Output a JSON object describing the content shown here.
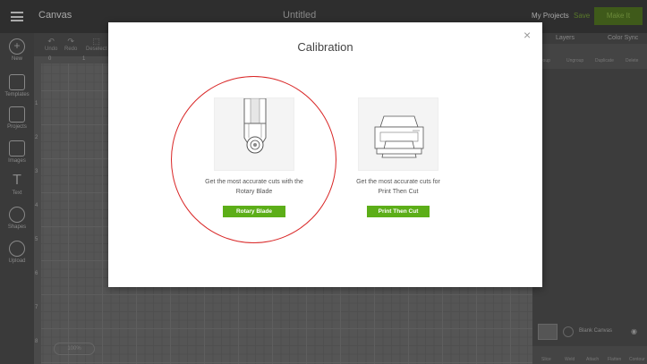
{
  "app": {
    "title": "Canvas",
    "document_title": "Untitled"
  },
  "header": {
    "my_projects": "My Projects",
    "save": "Save",
    "make_it": "Make It"
  },
  "sidebar": {
    "items": [
      {
        "label": "New",
        "icon": "plus-icon"
      },
      {
        "label": "Templates",
        "icon": "shirt-icon"
      },
      {
        "label": "Projects",
        "icon": "projects-icon"
      },
      {
        "label": "Images",
        "icon": "image-icon"
      },
      {
        "label": "Text",
        "icon": "text-icon"
      },
      {
        "label": "Shapes",
        "icon": "shapes-icon"
      },
      {
        "label": "Upload",
        "icon": "upload-icon"
      }
    ]
  },
  "toolbar": {
    "undo": "Undo",
    "redo": "Redo",
    "deselect": "Deselect"
  },
  "ruler": {
    "top": [
      "0",
      "1"
    ],
    "left": [
      "1",
      "2",
      "3",
      "4",
      "5",
      "6",
      "7",
      "8"
    ]
  },
  "right_panel": {
    "tabs": {
      "layers": "Layers",
      "color_sync": "Color Sync"
    },
    "tools": [
      "Group",
      "Ungroup",
      "Duplicate",
      "Delete"
    ],
    "blank_canvas": "Blank Canvas",
    "bottom_tools": [
      "Slice",
      "Weld",
      "Attach",
      "Flatten",
      "Contour"
    ]
  },
  "zoom_label": "100%",
  "modal": {
    "title": "Calibration",
    "close": "×",
    "options": [
      {
        "line1": "Get the most accurate cuts with the",
        "line2": "Rotary Blade",
        "button": "Rotary Blade"
      },
      {
        "line1": "Get the most accurate cuts for",
        "line2": "Print Then Cut",
        "button": "Print Then Cut"
      }
    ]
  },
  "colors": {
    "accent": "#5cae18",
    "highlight": "#d92626"
  }
}
